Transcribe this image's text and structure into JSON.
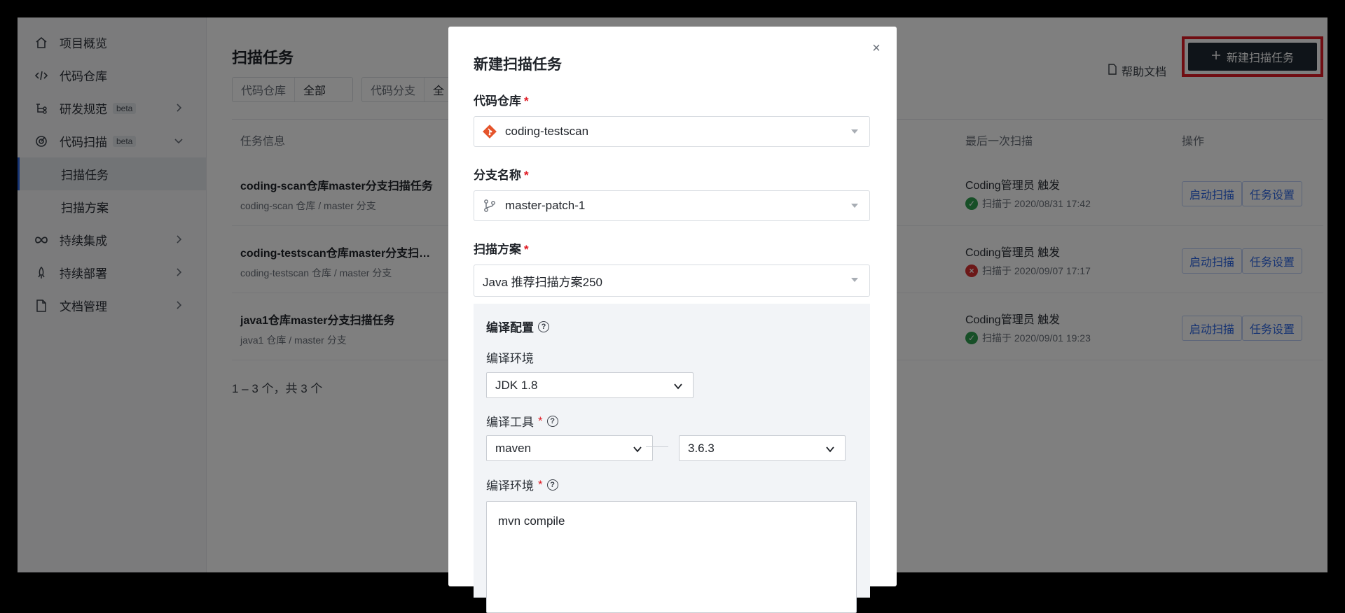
{
  "sidebar": {
    "items": [
      {
        "label": "项目概览",
        "icon": "home-icon"
      },
      {
        "label": "代码仓库",
        "icon": "code-icon"
      },
      {
        "label": "研发规范",
        "icon": "workflow-icon",
        "badge": "beta"
      },
      {
        "label": "代码扫描",
        "icon": "scan-icon",
        "badge": "beta"
      },
      {
        "label": "扫描任务"
      },
      {
        "label": "扫描方案"
      },
      {
        "label": "持续集成",
        "icon": "infinity-icon"
      },
      {
        "label": "持续部署",
        "icon": "rocket-icon"
      },
      {
        "label": "文档管理",
        "icon": "document-icon"
      }
    ]
  },
  "main": {
    "title": "扫描任务",
    "filters": [
      {
        "key": "代码仓库",
        "value": "全部"
      },
      {
        "key": "代码分支",
        "value": "全"
      }
    ],
    "help_label": "帮助文档",
    "new_button_label": "新建扫描任务",
    "columns": {
      "info": "任务信息",
      "last_scan": "最后一次扫描",
      "actions": "操作"
    },
    "rows": [
      {
        "name": "coding-scan仓库master分支扫描任务",
        "sub": "coding-scan 仓库 / master 分支",
        "trigger": "Coding管理员 触发",
        "scan_time": "扫描于 2020/08/31 17:42",
        "status": "success"
      },
      {
        "name": "coding-testscan仓库master分支扫…",
        "sub": "coding-testscan 仓库 / master 分支",
        "trigger": "Coding管理员 触发",
        "scan_time": "扫描于 2020/09/07 17:17",
        "status": "failed"
      },
      {
        "name": "java1仓库master分支扫描任务",
        "sub": "java1 仓库 / master 分支",
        "trigger": "Coding管理员 触发",
        "scan_time": "扫描于 2020/09/01 19:23",
        "status": "success"
      }
    ],
    "row_actions": {
      "start": "启动扫描",
      "settings": "任务设置"
    },
    "pagination": "1 – 3 个，共 3 个"
  },
  "modal": {
    "title": "新建扫描任务",
    "close": "×",
    "repo_label": "代码仓库",
    "repo_value": "coding-testscan",
    "branch_label": "分支名称",
    "branch_value": "master-patch-1",
    "plan_label": "扫描方案",
    "plan_value": "Java 推荐扫描方案250",
    "required_mark": "*",
    "compile": {
      "title": "编译配置",
      "env_label": "编译环境",
      "env_value": "JDK 1.8",
      "tool_label": "编译工具",
      "tool_value": "maven",
      "tool_version": "3.6.3",
      "cmd_label": "编译环境",
      "cmd_value": "mvn compile"
    }
  },
  "colors": {
    "accent": "#2d66e5",
    "highlight": "#e01b24",
    "primary_button": "#1f2933",
    "success": "#2e9e4f",
    "error": "#d93030"
  }
}
